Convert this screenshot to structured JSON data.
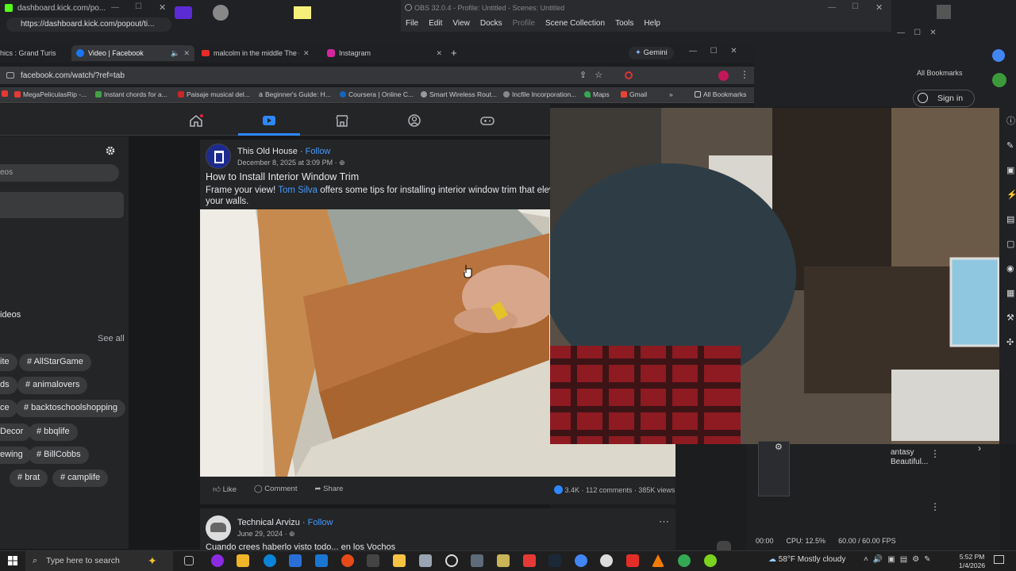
{
  "kick": {
    "title": "dashboard.kick.com/po...",
    "url": "https://dashboard.kick.com/popout/ti..."
  },
  "obs": {
    "title": "OBS 32.0.4 - Profile: Untitled - Scenes: Untitled",
    "menu": [
      "File",
      "Edit",
      "View",
      "Docks",
      "Profile",
      "Scene Collection",
      "Tools",
      "Help"
    ],
    "cpu": "CPU: 12.5%",
    "fps": "60.00 / 60.00 FPS",
    "time": "00:00"
  },
  "browser": {
    "tabs": [
      {
        "label": "hics : Grand Turis"
      },
      {
        "label": "Video | Facebook"
      },
      {
        "label": "malcolm in the middle The gre"
      },
      {
        "label": "Instagram"
      }
    ],
    "gemini": "Gemini",
    "url": "facebook.com/watch/?ref=tab",
    "bookmarks": [
      "MegaPeliculasRip -...",
      "Instant chords for a...",
      "Paisaje musical del...",
      "Beginner's Guide: H...",
      "Coursera | Online C...",
      "Smart Wireless Rout...",
      "Incfile Incorporation...",
      "Maps",
      "Gmail"
    ],
    "all_bookmarks": "All Bookmarks",
    "sign_in": "Sign in"
  },
  "left": {
    "eos": "eos",
    "videos": "ideos",
    "see_all": "See all",
    "tags": [
      "ite",
      "ds",
      "ce",
      "Decor",
      "ewing",
      "brat"
    ],
    "right_tags": [
      "# AllStarGame",
      "# animalovers",
      "# backtoschoolshopping",
      "# bbqlife",
      "# BillCobbs",
      "# camplife"
    ]
  },
  "post": {
    "author": "This Old House",
    "follow": "Follow",
    "date": "December 8, 2025 at 3:09 PM",
    "title": "How to Install Interior Window Trim",
    "text_a": "Frame your view! ",
    "mention": "Tom Silva",
    "text_b": " offers some tips for installing interior window trim that elev",
    "text_c": "your walls.",
    "like": "Like",
    "comment": "Comment",
    "share": "Share",
    "reactions": "3.4K",
    "comments": "112 comments",
    "views": "385K views"
  },
  "post2": {
    "author": "Technical Arvizu",
    "follow": "Follow",
    "date": "June 29, 2024",
    "text": "Cuando crees haberlo visto todo... en los Vochos"
  },
  "side_card": {
    "line1": "antasy",
    "line2": "Beautiful..."
  },
  "taskbar": {
    "search": "Type here to search",
    "weather": "58°F  Mostly cloudy",
    "time": "5:52 PM",
    "date": "1/4/2026"
  },
  "colors": {
    "fb_blue": "#2d88ff",
    "link": "#4599ff",
    "dark": "#242526"
  }
}
